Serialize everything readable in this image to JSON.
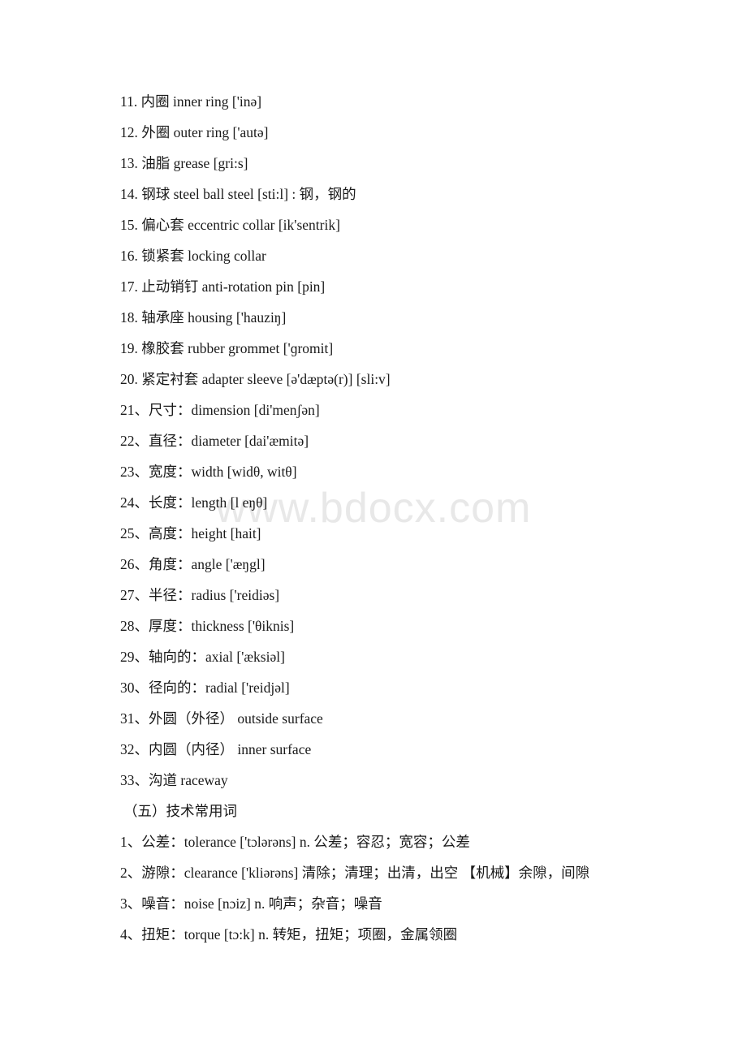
{
  "document": {
    "watermark": "www.bdocx.com",
    "background_color": "#ffffff",
    "text_color": "#1a1a1a",
    "watermark_color": "#e8e8e8"
  },
  "lines": [
    {
      "id": "item-11",
      "text": "11. 内圈  inner ring   ['inə]"
    },
    {
      "id": "item-12",
      "text": "12. 外圈  outer ring   ['autə]"
    },
    {
      "id": "item-13",
      "text": "13. 油脂 grease      [gri:s]"
    },
    {
      "id": "item-14",
      "text": "14. 钢球  steel ball     steel  [sti:l] : 钢，钢的"
    },
    {
      "id": "item-15",
      "text": "15. 偏心套 eccentric collar   [ik'sentrik]"
    },
    {
      "id": "item-16",
      "text": "16. 锁紧套  locking collar"
    },
    {
      "id": "item-17",
      "text": "17. 止动销钉 anti-rotation pin     [pin]"
    },
    {
      "id": "item-18",
      "text": "18. 轴承座     housing  ['hauziŋ]"
    },
    {
      "id": "item-19",
      "text": "19. 橡胶套     rubber grommet      ['ɡromit]"
    },
    {
      "id": "item-20",
      "text": "20. 紧定衬套 adapter sleeve   [ə'dæptə(r)]    [sli:v]"
    },
    {
      "id": "item-21",
      "text": "21、尺寸：dimension [di'menʃən]"
    },
    {
      "id": "item-22",
      "text": "22、直径：diameter [dai'æmitə]"
    },
    {
      "id": "item-23",
      "text": "23、宽度：width [widθ, witθ]"
    },
    {
      "id": "item-24",
      "text": "24、长度：length [l eŋθ]"
    },
    {
      "id": "item-25",
      "text": "25、高度：height [hait]"
    },
    {
      "id": "item-26",
      "text": "26、角度：angle ['æŋgl]"
    },
    {
      "id": "item-27",
      "text": "27、半径：radius ['reidiəs]"
    },
    {
      "id": "item-28",
      "text": "28、厚度：thickness ['θiknis]"
    },
    {
      "id": "item-29",
      "text": "29、轴向的：axial ['æksiəl]"
    },
    {
      "id": "item-30",
      "text": "30、径向的：radial ['reidjəl]"
    },
    {
      "id": "item-31",
      "text": "31、外圆（外径） outside surface"
    },
    {
      "id": "item-32",
      "text": "32、内圆（内径） inner surface"
    },
    {
      "id": "item-33",
      "text": "33、沟道 raceway"
    },
    {
      "id": "section-heading-five",
      "text": "（五）技术常用词",
      "heading": true
    },
    {
      "id": "tech-item-1",
      "text": "1、公差：tolerance ['tɔlərəns] n. 公差；容忍；宽容；公差"
    },
    {
      "id": "tech-item-2",
      "text": "2、游隙：clearance ['kliərəns] 清除；清理；出清，出空  【机械】余隙，间隙"
    },
    {
      "id": "tech-item-3",
      "text": "3、噪音：noise [nɔiz] n. 响声；杂音；噪音"
    },
    {
      "id": "tech-item-4",
      "text": "4、扭矩：torque [tɔ:k] n. 转矩，扭矩；项圈，金属领圈"
    }
  ]
}
